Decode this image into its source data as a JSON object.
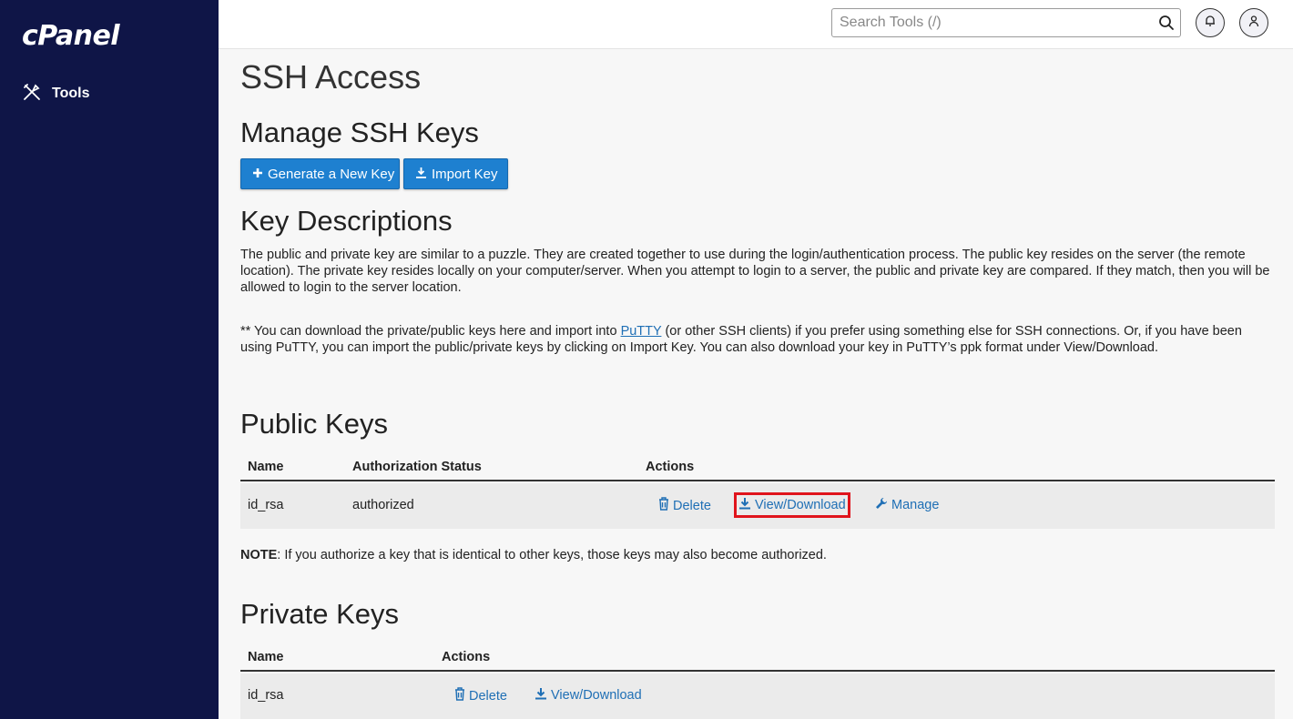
{
  "app": {
    "logo": "cPanel"
  },
  "sidebar": {
    "items": [
      {
        "label": "Tools",
        "icon": "tools-icon"
      }
    ]
  },
  "topbar": {
    "search_placeholder": "Search Tools (/)",
    "icons": [
      "search-icon",
      "bell-icon",
      "user-icon"
    ]
  },
  "page": {
    "title": "SSH Access",
    "manage_heading": "Manage SSH Keys",
    "buttons": {
      "generate": "Generate a New Key",
      "import": "Import Key"
    },
    "key_desc_heading": "Key Descriptions",
    "key_desc_text": "The public and private key are similar to a puzzle. They are created together to use during the login/authentication process. The public key resides on the server (the remote location). The private key resides locally on your computer/server. When you attempt to login to a server, the public and private key are compared. If they match, then you will be allowed to login to the server location.",
    "putty_before": "** You can download the private/public keys here and import into ",
    "putty_link": "PuTTY",
    "putty_after": " (or other SSH clients) if you prefer using something else for SSH connections. Or, if you have been using PuTTY, you can import the public/private keys by clicking on Import Key. You can also download your key in PuTTY’s ppk format under View/Download."
  },
  "public_keys": {
    "heading": "Public Keys",
    "columns": [
      "Name",
      "Authorization Status",
      "Actions"
    ],
    "rows": [
      {
        "name": "id_rsa",
        "status": "authorized",
        "actions": {
          "delete": "Delete",
          "view": "View/Download",
          "manage": "Manage"
        }
      }
    ],
    "note_label": "NOTE",
    "note_text": ": If you authorize a key that is identical to other keys, those keys may also become authorized."
  },
  "private_keys": {
    "heading": "Private Keys",
    "columns": [
      "Name",
      "Actions"
    ],
    "rows": [
      {
        "name": "id_rsa",
        "actions": {
          "delete": "Delete",
          "view": "View/Download"
        }
      }
    ]
  },
  "colors": {
    "sidebar": "#0f1547",
    "button": "#1e80d0",
    "link": "#1f6fb5",
    "highlight": "#e0141c"
  }
}
